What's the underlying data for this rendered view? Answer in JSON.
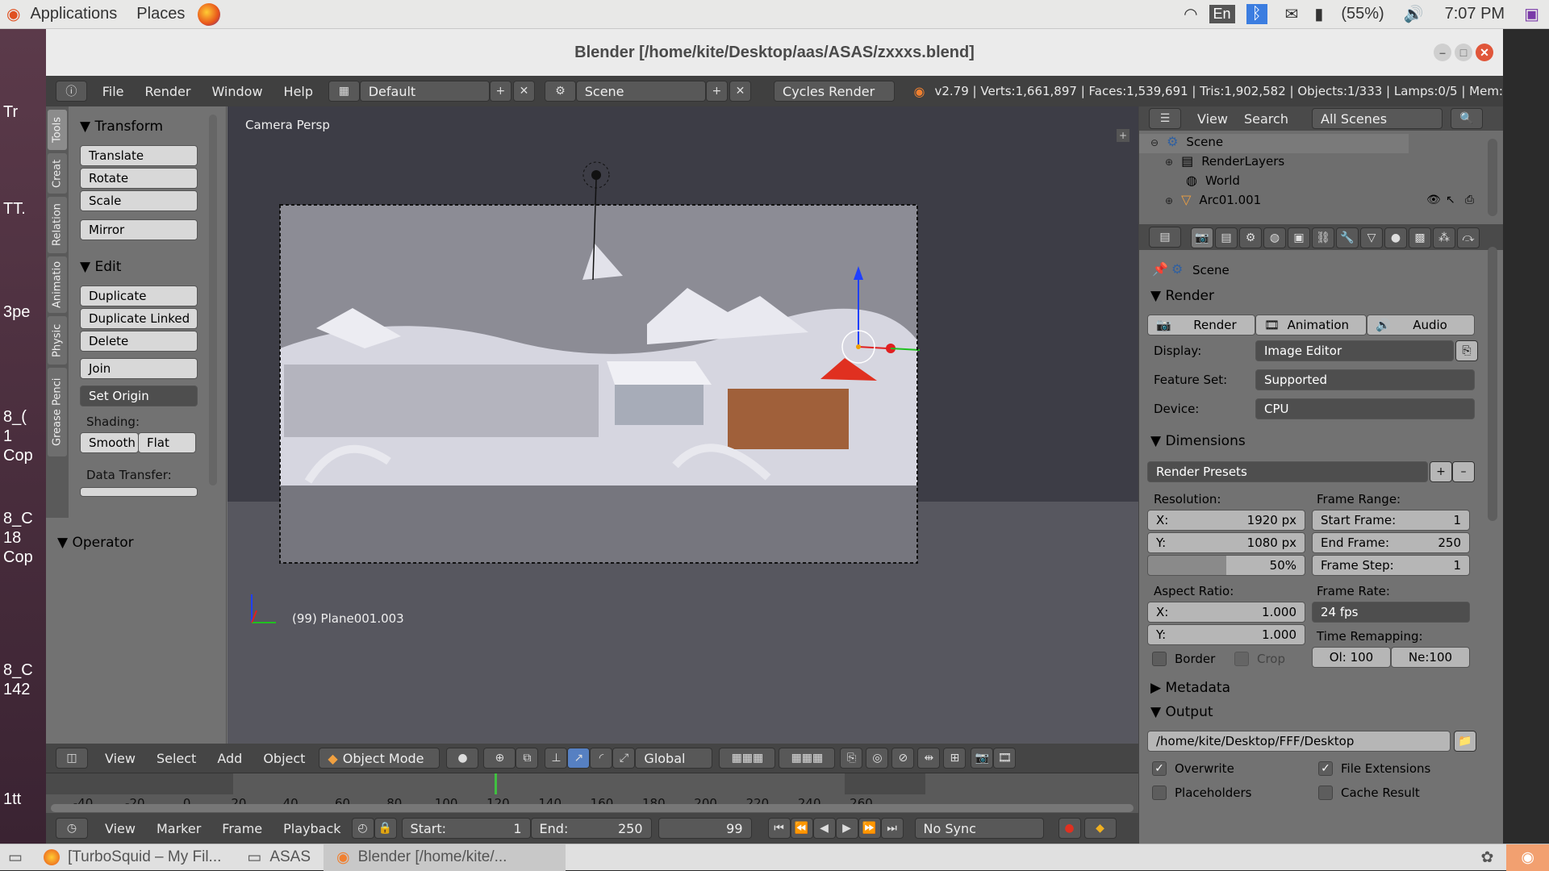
{
  "topbar": {
    "apps": "Applications",
    "places": "Places",
    "lang": "En",
    "battery": "(55%)",
    "time": "7:07 PM"
  },
  "desktop": {
    "labels": [
      "Tr",
      "TT.",
      "3pe",
      "8_(",
      "1",
      "Cop",
      "8_C",
      "18",
      "Cop",
      "8_C",
      "142",
      "1tt"
    ]
  },
  "window": {
    "title": "Blender [/home/kite/Desktop/aas/ASAS/zxxxs.blend]"
  },
  "infobar": {
    "menus": [
      "File",
      "Render",
      "Window",
      "Help"
    ],
    "layout": "Default",
    "scene": "Scene",
    "engine": "Cycles Render",
    "stats": "v2.79 | Verts:1,661,897 | Faces:1,539,691 | Tris:1,902,582 | Objects:1/333 | Lamps:0/5 | Mem:"
  },
  "toolshelf": {
    "tabs": [
      "Tools",
      "Creat",
      "Relation",
      "Animatio",
      "Physic",
      "Grease Penci"
    ],
    "transform": {
      "title": "Transform",
      "buttons": [
        "Translate",
        "Rotate",
        "Scale",
        "Mirror"
      ]
    },
    "edit": {
      "title": "Edit",
      "buttons": [
        "Duplicate",
        "Duplicate Linked",
        "Delete",
        "Join"
      ],
      "set_origin": "Set Origin"
    },
    "shading": {
      "label": "Shading:",
      "smooth": "Smooth",
      "flat": "Flat"
    },
    "data_transfer": "Data Transfer:",
    "operator": "Operator"
  },
  "viewport": {
    "mode_label": "Camera Persp",
    "object_label": "(99) Plane001.003"
  },
  "view3d_header": {
    "menus": [
      "View",
      "Select",
      "Add",
      "Object"
    ],
    "mode": "Object Mode",
    "orientation": "Global"
  },
  "timeline": {
    "ticks": [
      "-40",
      "-20",
      "0",
      "20",
      "40",
      "60",
      "80",
      "100",
      "120",
      "140",
      "160",
      "180",
      "200",
      "220",
      "240",
      "260"
    ],
    "current_frame_fraction": 0.467
  },
  "timeline_header": {
    "menus": [
      "View",
      "Marker",
      "Frame",
      "Playback"
    ],
    "start_label": "Start:",
    "start": "1",
    "end_label": "End:",
    "end": "250",
    "current": "99",
    "sync": "No Sync"
  },
  "outliner": {
    "menus": [
      "View",
      "Search"
    ],
    "filter": "All Scenes",
    "items": [
      "Scene",
      "RenderLayers",
      "World",
      "Arc01.001"
    ]
  },
  "properties": {
    "context": "Scene",
    "render": {
      "title": "Render",
      "buttons": [
        "Render",
        "Animation",
        "Audio"
      ],
      "display_label": "Display:",
      "display": "Image Editor",
      "feature_label": "Feature Set:",
      "feature": "Supported",
      "device_label": "Device:",
      "device": "CPU"
    },
    "dimensions": {
      "title": "Dimensions",
      "presets": "Render Presets",
      "resolution_label": "Resolution:",
      "res_x_label": "X:",
      "res_x": "1920 px",
      "res_y_label": "Y:",
      "res_y": "1080 px",
      "res_pct": "50%",
      "frame_range_label": "Frame Range:",
      "start_label": "Start Frame:",
      "start": "1",
      "end_label": "End Frame:",
      "end": "250",
      "step_label": "Frame Step:",
      "step": "1",
      "aspect_label": "Aspect Ratio:",
      "asp_x_label": "X:",
      "asp_x": "1.000",
      "asp_y_label": "Y:",
      "asp_y": "1.000",
      "frame_rate_label": "Frame Rate:",
      "frame_rate": "24 fps",
      "remap_label": "Time Remapping:",
      "remap_old": "Ol: 100",
      "remap_new": "Ne:100",
      "border": "Border",
      "crop": "Crop"
    },
    "metadata": "Metadata",
    "output": {
      "title": "Output",
      "path": "/home/kite/Desktop/FFF/Desktop",
      "overwrite": "Overwrite",
      "file_ext": "File Extensions",
      "placeholders": "Placeholders",
      "cache": "Cache Result"
    }
  },
  "taskbar": {
    "items": [
      "[TurboSquid – My Fil...",
      "ASAS",
      "Blender [/home/kite/..."
    ]
  }
}
